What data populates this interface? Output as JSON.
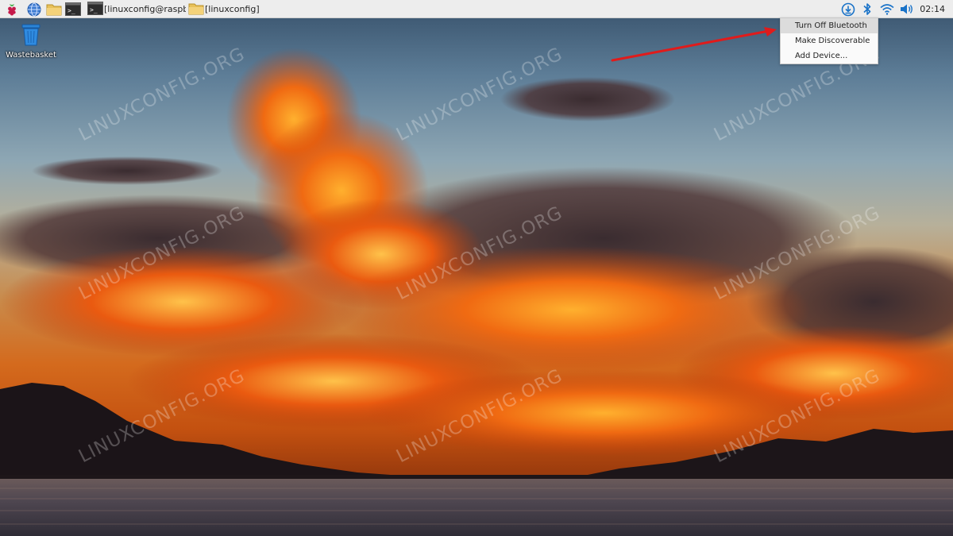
{
  "taskbar": {
    "icons": [
      "raspberry-menu-icon",
      "web-browser-icon",
      "file-manager-icon",
      "terminal-icon"
    ],
    "tasks": [
      {
        "icon": "terminal-icon",
        "label": "[linuxconfig@raspber..."
      },
      {
        "icon": "folder-icon",
        "label": "[linuxconfig]"
      }
    ],
    "tray_icons": [
      "update-download-icon",
      "bluetooth-icon",
      "wifi-icon",
      "volume-icon"
    ],
    "clock": "02:14"
  },
  "desktop": {
    "icons": [
      {
        "label": "Wastebasket",
        "icon": "wastebasket-icon"
      }
    ],
    "watermark": "LINUXCONFIG.ORG"
  },
  "bluetooth_menu": {
    "items": [
      {
        "label": "Turn Off Bluetooth",
        "highlighted": true
      },
      {
        "label": "Make Discoverable",
        "highlighted": false
      },
      {
        "label": "Add Device...",
        "highlighted": false
      }
    ]
  },
  "colors": {
    "taskbar_bg": "#ededed",
    "menu_bg": "#fafafa",
    "menu_highlight": "#dcdcdc",
    "accent_blue": "#1a73c8",
    "annotation_arrow": "#e01b1b"
  }
}
